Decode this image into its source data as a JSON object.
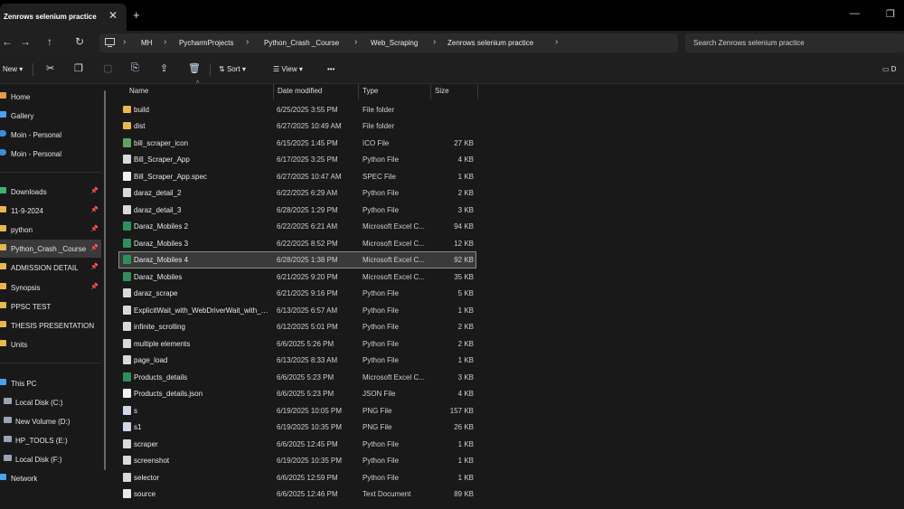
{
  "window": {
    "tab_title": "Zenrows selenium practice",
    "tab_close": "✕",
    "new_tab": "+",
    "minimize": "—",
    "maximize": "❐"
  },
  "nav": {
    "back": "←",
    "forward": "→",
    "up": "↑",
    "refresh": "↻"
  },
  "breadcrumbs": [
    "MH",
    "PycharmProjects",
    "Python_Crash _Course",
    "Web_Scraping",
    "Zenrows selenium practice"
  ],
  "search": {
    "placeholder": "Search Zenrows selenium practice"
  },
  "toolbar": {
    "new_label": "New",
    "sort_label": "Sort",
    "view_label": "View",
    "more_label": "•••",
    "details_label": "D"
  },
  "sidebar": {
    "items": [
      {
        "label": "Home",
        "icon": "home-icon"
      },
      {
        "label": "Gallery",
        "icon": "gallery-icon"
      },
      {
        "label": "Moin - Personal",
        "icon": "cloud-icon"
      },
      {
        "label": "Moin - Personal",
        "icon": "cloud-icon"
      },
      {
        "label": "Downloads",
        "icon": "download-icon",
        "pinned": true
      },
      {
        "label": "11-9-2024",
        "icon": "folder-icon",
        "pinned": true
      },
      {
        "label": "python",
        "icon": "folder-icon",
        "pinned": true
      },
      {
        "label": "Python_Crash _Course",
        "icon": "folder-icon",
        "pinned": true,
        "active": true
      },
      {
        "label": "ADMISSION DETAIL",
        "icon": "folder-icon",
        "pinned": true
      },
      {
        "label": "Synopsis",
        "icon": "folder-icon",
        "pinned": true
      },
      {
        "label": "PPSC TEST",
        "icon": "folder-icon"
      },
      {
        "label": "THESIS PRESENTATION",
        "icon": "folder-icon"
      },
      {
        "label": "Units",
        "icon": "folder-icon"
      },
      {
        "label": "This PC",
        "icon": "pc-icon"
      },
      {
        "label": "Local Disk (C:)",
        "icon": "drive-icon"
      },
      {
        "label": "New Volume (D:)",
        "icon": "drive-icon"
      },
      {
        "label": "HP_TOOLS (E:)",
        "icon": "drive-icon"
      },
      {
        "label": "Local Disk (F:)",
        "icon": "drive-icon"
      },
      {
        "label": "Network",
        "icon": "network-icon"
      }
    ]
  },
  "columns": {
    "name": "Name",
    "date": "Date modified",
    "type": "Type",
    "size": "Size"
  },
  "files": [
    {
      "name": "build",
      "date": "6/25/2025 3:55 PM",
      "type": "File folder",
      "size": "",
      "kind": "folder"
    },
    {
      "name": "dist",
      "date": "6/27/2025 10:49 AM",
      "type": "File folder",
      "size": "",
      "kind": "folder"
    },
    {
      "name": "bill_scraper_icon",
      "date": "6/15/2025 1:45 PM",
      "type": "ICO File",
      "size": "27 KB",
      "kind": "ico"
    },
    {
      "name": "Bill_Scraper_App",
      "date": "6/17/2025 3:25 PM",
      "type": "Python File",
      "size": "4 KB",
      "kind": "py"
    },
    {
      "name": "Bill_Scraper_App.spec",
      "date": "6/27/2025 10:47 AM",
      "type": "SPEC File",
      "size": "1 KB",
      "kind": "doc"
    },
    {
      "name": "daraz_detail_2",
      "date": "6/22/2025 6:29 AM",
      "type": "Python File",
      "size": "2 KB",
      "kind": "py"
    },
    {
      "name": "daraz_detail_3",
      "date": "6/28/2025 1:29 PM",
      "type": "Python File",
      "size": "3 KB",
      "kind": "py"
    },
    {
      "name": "Daraz_Mobiles 2",
      "date": "6/22/2025 6:21 AM",
      "type": "Microsoft Excel C...",
      "size": "94 KB",
      "kind": "xl"
    },
    {
      "name": "Daraz_Mobiles 3",
      "date": "6/22/2025 8:52 PM",
      "type": "Microsoft Excel C...",
      "size": "12 KB",
      "kind": "xl"
    },
    {
      "name": "Daraz_Mobiles 4",
      "date": "6/28/2025 1:38 PM",
      "type": "Microsoft Excel C...",
      "size": "92 KB",
      "kind": "xl",
      "selected": true
    },
    {
      "name": "Daraz_Mobiles",
      "date": "6/21/2025 9:20 PM",
      "type": "Microsoft Excel C...",
      "size": "35 KB",
      "kind": "xl"
    },
    {
      "name": "daraz_scrape",
      "date": "6/21/2025 9:16 PM",
      "type": "Python File",
      "size": "5 KB",
      "kind": "py"
    },
    {
      "name": "ExplicitWait_with_WebDriverWait_with_ex...",
      "date": "6/13/2025 6:57 AM",
      "type": "Python File",
      "size": "1 KB",
      "kind": "py"
    },
    {
      "name": "infinite_scrolling",
      "date": "6/12/2025 5:01 PM",
      "type": "Python File",
      "size": "2 KB",
      "kind": "py"
    },
    {
      "name": "multiple elements",
      "date": "6/6/2025 5:26 PM",
      "type": "Python File",
      "size": "2 KB",
      "kind": "py"
    },
    {
      "name": "page_load",
      "date": "6/13/2025 8:33 AM",
      "type": "Python File",
      "size": "1 KB",
      "kind": "py"
    },
    {
      "name": "Products_details",
      "date": "6/6/2025 5:23 PM",
      "type": "Microsoft Excel C...",
      "size": "3 KB",
      "kind": "xl"
    },
    {
      "name": "Products_details.json",
      "date": "6/6/2025 5:23 PM",
      "type": "JSON File",
      "size": "4 KB",
      "kind": "doc"
    },
    {
      "name": "s",
      "date": "6/19/2025 10:05 PM",
      "type": "PNG File",
      "size": "157 KB",
      "kind": "png"
    },
    {
      "name": "s1",
      "date": "6/19/2025 10:35 PM",
      "type": "PNG File",
      "size": "26 KB",
      "kind": "png"
    },
    {
      "name": "scraper",
      "date": "6/6/2025 12:45 PM",
      "type": "Python File",
      "size": "1 KB",
      "kind": "py"
    },
    {
      "name": "screenshot",
      "date": "6/19/2025 10:35 PM",
      "type": "Python File",
      "size": "1 KB",
      "kind": "py"
    },
    {
      "name": "selector",
      "date": "6/6/2025 12:59 PM",
      "type": "Python File",
      "size": "1 KB",
      "kind": "py"
    },
    {
      "name": "source",
      "date": "6/6/2025 12:46 PM",
      "type": "Text Document",
      "size": "89 KB",
      "kind": "txt"
    }
  ],
  "colors": {
    "folder": "#e8b94a",
    "selection": "#3a3a3a",
    "accent": "#4aa3f0"
  }
}
